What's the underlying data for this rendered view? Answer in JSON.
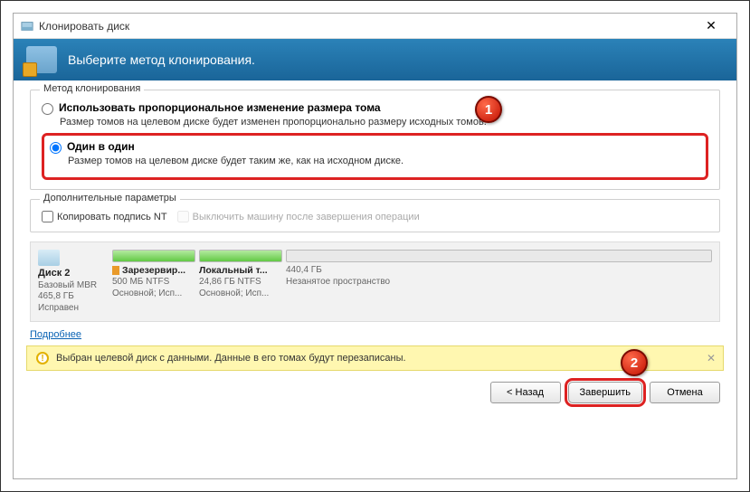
{
  "titlebar": {
    "title": "Клонировать диск"
  },
  "header": {
    "text": "Выберите метод клонирования."
  },
  "method_group": {
    "legend": "Метод клонирования",
    "opt1_label": "Использовать пропорциональное изменение размера тома",
    "opt1_desc": "Размер томов на целевом диске будет изменен пропорционально размеру исходных томов.",
    "opt2_label": "Один в один",
    "opt2_desc": "Размер томов на целевом диске будет таким же, как на исходном диске."
  },
  "extra_group": {
    "legend": "Дополнительные параметры",
    "chk1": "Копировать подпись NT",
    "chk2": "Выключить машину после завершения операции"
  },
  "disk": {
    "name": "Диск 2",
    "type": "Базовый MBR",
    "size": "465,8 ГБ",
    "status": "Исправен",
    "p1": {
      "name": "Зарезервир...",
      "size": "500 МБ NTFS",
      "kind": "Основной; Исп..."
    },
    "p2": {
      "name": "Локальный т...",
      "size": "24,86 ГБ NTFS",
      "kind": "Основной; Исп..."
    },
    "p3": {
      "name": "",
      "size": "440,4 ГБ",
      "kind": "Незанятое пространство"
    }
  },
  "more_link": "Подробнее",
  "warning": "Выбран целевой диск с данными. Данные в его томах будут перезаписаны.",
  "buttons": {
    "back": "< Назад",
    "finish": "Завершить",
    "cancel": "Отмена"
  },
  "markers": {
    "m1": "1",
    "m2": "2"
  }
}
